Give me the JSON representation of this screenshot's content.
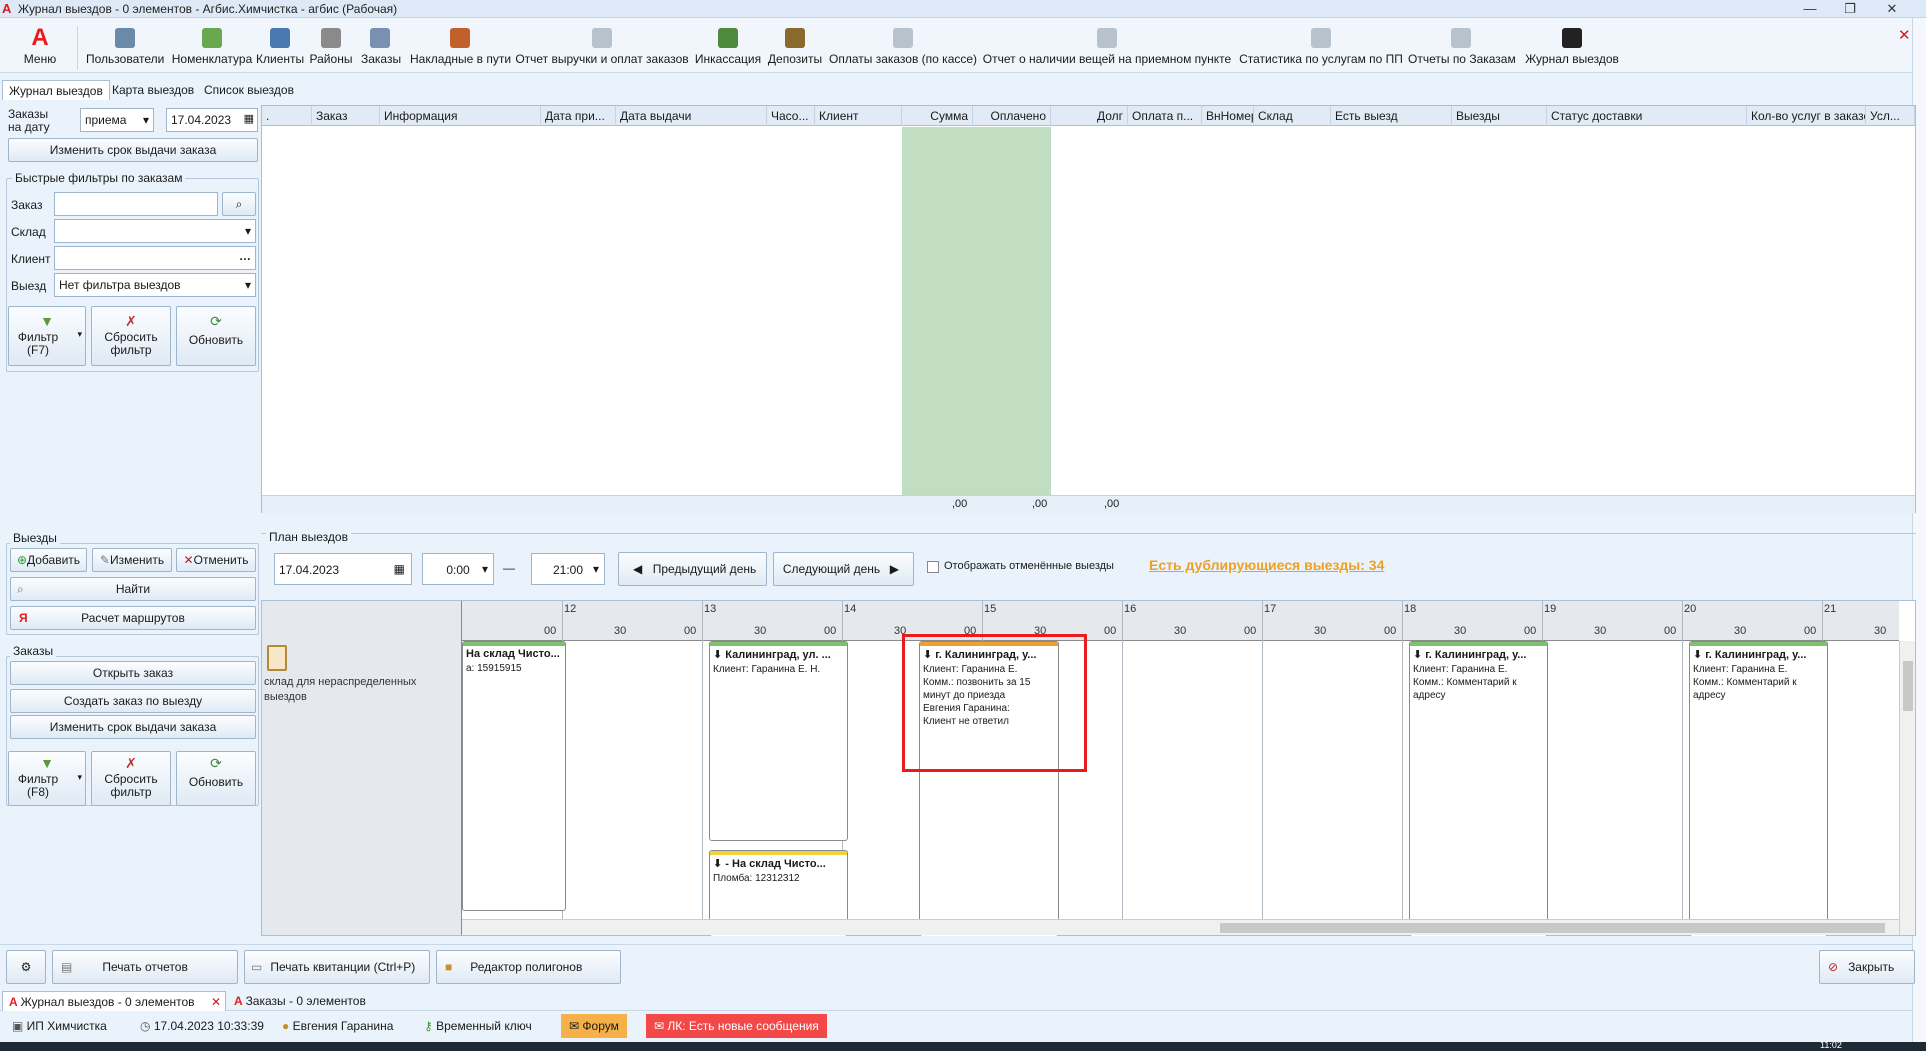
{
  "window": {
    "title": "Журнал выездов - 0 элементов - Агбис.Химчистка - агбис (Рабочая)",
    "controls": [
      "—",
      "❐",
      "✕"
    ]
  },
  "ribbon": {
    "menu_label": "Меню",
    "items": [
      {
        "label": "Пользователи",
        "icon": "users-icon",
        "color": "#6b8aa8"
      },
      {
        "label": "Номенклатура",
        "icon": "basket-icon",
        "color": "#6aa84f"
      },
      {
        "label": "Клиенты",
        "icon": "clients-icon",
        "color": "#4a78b0"
      },
      {
        "label": "Районы",
        "icon": "districts-icon",
        "color": "#8a8a8a"
      },
      {
        "label": "Заказы",
        "icon": "orders-icon",
        "color": "#7a90b0"
      },
      {
        "label": "Накладные в пути",
        "icon": "truck-icon",
        "color": "#c0602a"
      },
      {
        "label": "Отчет выручки и оплат заказов",
        "icon": "report-icon",
        "color": "#b8c2cc"
      },
      {
        "label": "Инкассация",
        "icon": "cash-icon",
        "color": "#4d8a3c"
      },
      {
        "label": "Депозиты",
        "icon": "deposit-icon",
        "color": "#8a6a2c"
      },
      {
        "label": "Оплаты заказов (по кассе)",
        "icon": "payments-icon",
        "color": "#b8c2cc"
      },
      {
        "label": "Отчет о наличии вещей на приемном пункте",
        "icon": "stock-report-icon",
        "color": "#b8c2cc"
      },
      {
        "label": "Статистика по услугам по ПП",
        "icon": "statistics-icon",
        "color": "#b8c2cc"
      },
      {
        "label": "Отчеты по Заказам",
        "icon": "order-reports-icon",
        "color": "#b8c2cc"
      },
      {
        "label": "Журнал выездов",
        "icon": "journal-icon",
        "color": "#222222"
      }
    ],
    "close_x": "✕"
  },
  "tabs": [
    "Журнал выездов",
    "Карта выездов",
    "Список выездов"
  ],
  "left": {
    "orders_on_date_label": "Заказы на дату",
    "date_type": "приема",
    "date_value": "17.04.2023",
    "change_deadline_btn": "Изменить срок выдачи заказа",
    "quick_filters_title": "Быстрые фильтры по заказам",
    "order_label": "Заказ",
    "order_value": "",
    "warehouse_label": "Склад",
    "warehouse_value": "",
    "client_label": "Клиент",
    "client_value": "",
    "trip_label": "Выезд",
    "trip_value": "Нет фильтра выездов",
    "filter_f7": "Фильтр (F7)",
    "reset_filter": "Сбросить фильтр",
    "refresh": "Обновить",
    "trips_title": "Выезды",
    "add_btn": "Добавить",
    "edit_btn": "Изменить",
    "cancel_btn": "Отменить",
    "find_btn": "Найти",
    "route_btn": "Расчет маршрутов",
    "orders_title": "Заказы",
    "open_order_btn": "Открыть заказ",
    "create_order_btn": "Создать заказ по выезду",
    "change_deadline_btn2": "Изменить срок выдачи заказа",
    "filter_f8": "Фильтр (F8)",
    "reset_filter2": "Сбросить фильтр",
    "refresh2": "Обновить"
  },
  "grid": {
    "columns": [
      ".",
      "Заказ",
      "Информация",
      "Дата при...",
      "Дата выдачи",
      "Часо...",
      "Клиент",
      "Сумма",
      "Оплачено",
      "Долг",
      "Оплата п...",
      "ВнНомер",
      "Склад",
      "Есть выезд",
      "Выезды",
      "Статус доставки",
      "Кол-во услуг в заказе",
      "Усл..."
    ],
    "totals": {
      "sum": ",00",
      "paid": ",00",
      "debt": ",00"
    }
  },
  "plan": {
    "title": "План выездов",
    "date": "17.04.2023",
    "time_from": "0:00",
    "time_to": "21:00",
    "dash": "—",
    "prev_day": "Предыдущий день",
    "next_day": "Следующий день",
    "show_cancelled": "Отображать отменённые выезды",
    "duplicates_link": "Есть дублирующиеся выезды: 34",
    "hours": [
      "12",
      "13",
      "14",
      "15",
      "16",
      "17",
      "18",
      "19",
      "20",
      "21"
    ],
    "half_labels": [
      "00",
      "30"
    ],
    "resource_label": "склад для нераспределенных выездов",
    "cards": [
      {
        "title": "На склад Чисто...",
        "body": "а: 15915915",
        "color": "#7cc36b"
      },
      {
        "title": "Калининград, ул. ...",
        "body": "Клиент: Гаранина Е. Н.",
        "color": "#7cc36b"
      },
      {
        "title": "- На склад Чисто...",
        "body": "Пломба: 12312312",
        "color": "#f0d23c"
      },
      {
        "title": "г. Калининград, у...",
        "body": "Клиент: Гаранина Е.\nКомм.: позвонить за 15 минут до приезда\nЕвгения Гаранина:\nКлиент не ответил",
        "color": "#f0a030"
      },
      {
        "title": "г. Калининград, у...",
        "body": "Клиент: Гаранина Е.\nКомм.: Комментарий к адресу",
        "color": "#7cc36b"
      },
      {
        "title": "г. Калининград, у...",
        "body": "Клиент: Гаранина Е.\nКомм.: Комментарий к адресу",
        "color": "#7cc36b"
      }
    ]
  },
  "bottom": {
    "print_reports": "Печать отчетов",
    "print_receipt": "Печать квитанции (Ctrl+P)",
    "polygon_editor": "Редактор полигонов",
    "close": "Закрыть"
  },
  "doc_tabs": [
    "Журнал выездов - 0 элементов",
    "Заказы - 0 элементов"
  ],
  "status": {
    "company": "ИП Химчистка",
    "datetime": "17.04.2023 10:33:39",
    "user": "Евгения Гаранина",
    "key": "Временный ключ",
    "forum": "Форум",
    "messages": "ЛК: Есть новые сообщения",
    "clock": "11:02"
  },
  "accent_color": "#e81c1c",
  "link_color": "#f0a020"
}
